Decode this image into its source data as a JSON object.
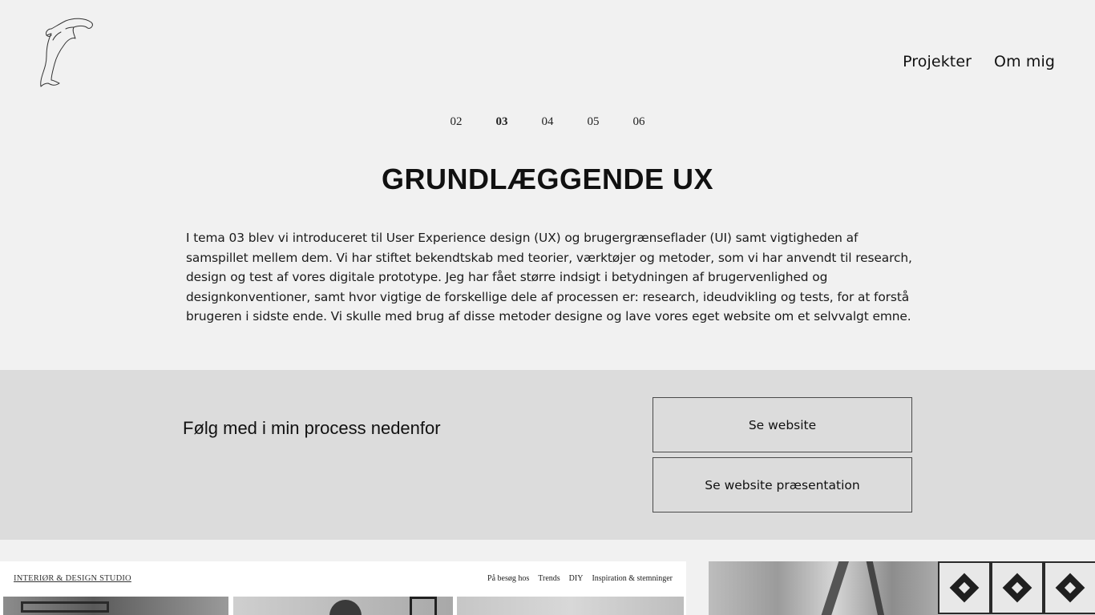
{
  "header": {
    "logo_icon": "dolphin-icon",
    "nav": [
      "Projekter",
      "Om mig"
    ]
  },
  "pager": {
    "items": [
      "02",
      "03",
      "04",
      "05",
      "06"
    ],
    "active": "03"
  },
  "main": {
    "title": "GRUNDLÆGGENDE UX",
    "intro": "I tema 03 blev vi introduceret til User Experience design (UX) og brugergrænseflader (UI) samt vigtigheden af samspillet mellem dem. Vi har stiftet bekendtskab med teorier, værktøjer og metoder, som vi har anvendt til research, design og test af vores digitale prototype. Jeg har fået større indsigt i betydningen af brugervenlighed og designkonventioner, samt hvor vigtige de forskellige dele af processen er: research, ideudvikling og tests, for at forstå brugeren i sidste ende. Vi skulle med brug af disse metoder designe og lave vores eget website om et selvvalgt emne."
  },
  "cta": {
    "heading": "Følg med i min process nedenfor",
    "button_website": "Se website",
    "button_presentation": "Se website præsentation"
  },
  "preview": {
    "brand": "INTERIØR & DESIGN STUDIO",
    "nav": [
      "På besøg hos",
      "Trends",
      "DIY",
      "Inspiration & stemninger"
    ]
  },
  "colors": {
    "background": "#f1f1f1",
    "band": "#dcdcdc",
    "text": "#111111"
  }
}
